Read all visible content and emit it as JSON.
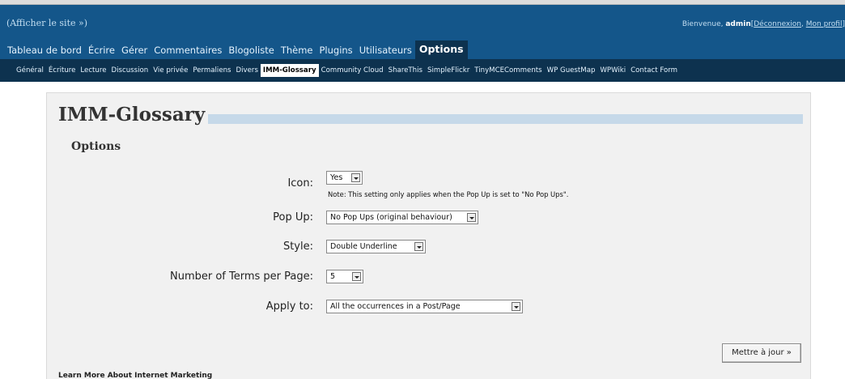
{
  "header": {
    "site_link": "(Afficher le site »)",
    "welcome": "Bienvenue,",
    "username": "admin",
    "logout_open": "[",
    "logout": "Déconnexion",
    "separator": ",",
    "profile": "Mon profil",
    "profile_close": "]"
  },
  "main_menu": [
    {
      "label": "Tableau de bord",
      "current": false
    },
    {
      "label": "Écrire",
      "current": false
    },
    {
      "label": "Gérer",
      "current": false
    },
    {
      "label": "Commentaires",
      "current": false
    },
    {
      "label": "Blogoliste",
      "current": false
    },
    {
      "label": "Thème",
      "current": false
    },
    {
      "label": "Plugins",
      "current": false
    },
    {
      "label": "Utilisateurs",
      "current": false
    },
    {
      "label": "Options",
      "current": true
    }
  ],
  "sub_menu": [
    {
      "label": "Général",
      "current": false
    },
    {
      "label": "Écriture",
      "current": false
    },
    {
      "label": "Lecture",
      "current": false
    },
    {
      "label": "Discussion",
      "current": false
    },
    {
      "label": "Vie privée",
      "current": false
    },
    {
      "label": "Permaliens",
      "current": false
    },
    {
      "label": "Divers",
      "current": false
    },
    {
      "label": "IMM-Glossary",
      "current": true
    },
    {
      "label": "Community Cloud",
      "current": false
    },
    {
      "label": "ShareThis",
      "current": false
    },
    {
      "label": "SimpleFlickr",
      "current": false
    },
    {
      "label": "TinyMCEComments",
      "current": false
    },
    {
      "label": "WP GuestMap",
      "current": false
    },
    {
      "label": "WPWiki",
      "current": false
    },
    {
      "label": "Contact Form",
      "current": false
    }
  ],
  "page": {
    "title": "IMM-Glossary",
    "section_heading": "Options"
  },
  "form": {
    "icon_label": "Icon:",
    "icon_value": "Yes",
    "icon_note": "Note: This setting only applies when the Pop Up is set to \"No Pop Ups\".",
    "popup_label": "Pop Up:",
    "popup_value": "No Pop Ups (original behaviour)",
    "style_label": "Style:",
    "style_value": "Double Underline",
    "terms_label": "Number of Terms per Page:",
    "terms_value": "5",
    "apply_label": "Apply to:",
    "apply_value": "All the occurrences in a Post/Page",
    "update_button": "Mettre à jour »"
  },
  "footer": {
    "learn_more": "Learn More About Internet Marketing"
  },
  "colors": {
    "header_bg": "#14568a",
    "submenu_bg": "#0d324f",
    "content_bg": "#f1f1f1",
    "title_rule": "#c6d9e9"
  }
}
